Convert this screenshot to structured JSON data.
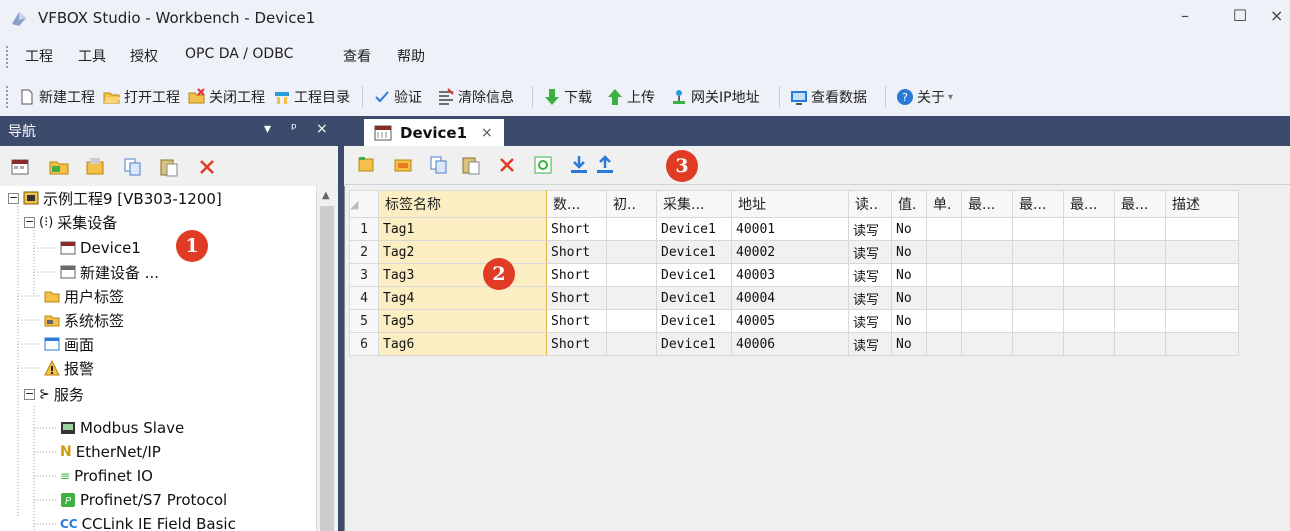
{
  "window": {
    "title": "VFBOX Studio - Workbench - Device1",
    "minimize": "–",
    "maximize": "☐",
    "close": "×"
  },
  "menu": [
    "工程",
    "工具",
    "授权",
    "OPC DA / ODBC",
    "查看",
    "帮助"
  ],
  "toolbar": {
    "new_project": "新建工程",
    "open_project": "打开工程",
    "close_project": "关闭工程",
    "project_dir": "工程目录",
    "verify": "验证",
    "clear_info": "清除信息",
    "download": "下载",
    "upload": "上传",
    "gateway_ip": "网关IP地址",
    "view_data": "查看数据",
    "about": "关于"
  },
  "nav": {
    "title": "导航",
    "controls": [
      "▾",
      "ᵖ",
      "×"
    ],
    "tree": {
      "root": "示例工程9 [VB303-1200]",
      "collect_devices": "采集设备",
      "device1": "Device1",
      "new_device": "新建设备 ...",
      "user_tags": "用户标签",
      "system_tags": "系统标签",
      "screen": "画面",
      "alarm": "报警",
      "services": "服务",
      "modbus_slave": "Modbus Slave",
      "ethernet_ip": "EtherNet/IP",
      "profinet_io": "Profinet IO",
      "profinet_s7": "Profinet/S7 Protocol",
      "cclink": "CCLink IE Field Basic"
    }
  },
  "doc_tab": {
    "label": "Device1",
    "close": "×"
  },
  "table": {
    "headers": [
      "标签名称",
      "数...",
      "初..",
      "采集...",
      "地址",
      "读..",
      "值.",
      "单.",
      "最...",
      "最...",
      "最...",
      "最...",
      "描述"
    ],
    "rows": [
      [
        "1",
        "Tag1",
        "Short",
        "",
        "Device1",
        "40001",
        "读写",
        "No"
      ],
      [
        "2",
        "Tag2",
        "Short",
        "",
        "Device1",
        "40002",
        "读写",
        "No"
      ],
      [
        "3",
        "Tag3",
        "Short",
        "",
        "Device1",
        "40003",
        "读写",
        "No"
      ],
      [
        "4",
        "Tag4",
        "Short",
        "",
        "Device1",
        "40004",
        "读写",
        "No"
      ],
      [
        "5",
        "Tag5",
        "Short",
        "",
        "Device1",
        "40005",
        "读写",
        "No"
      ],
      [
        "6",
        "Tag6",
        "Short",
        "",
        "Device1",
        "40006",
        "读写",
        "No"
      ]
    ]
  },
  "badges": [
    "1",
    "2",
    "3"
  ],
  "colors": {
    "nav_dark": "#3c4a6c",
    "badge_red": "#e03b24",
    "tag_col_bg": "#fbeec2"
  }
}
